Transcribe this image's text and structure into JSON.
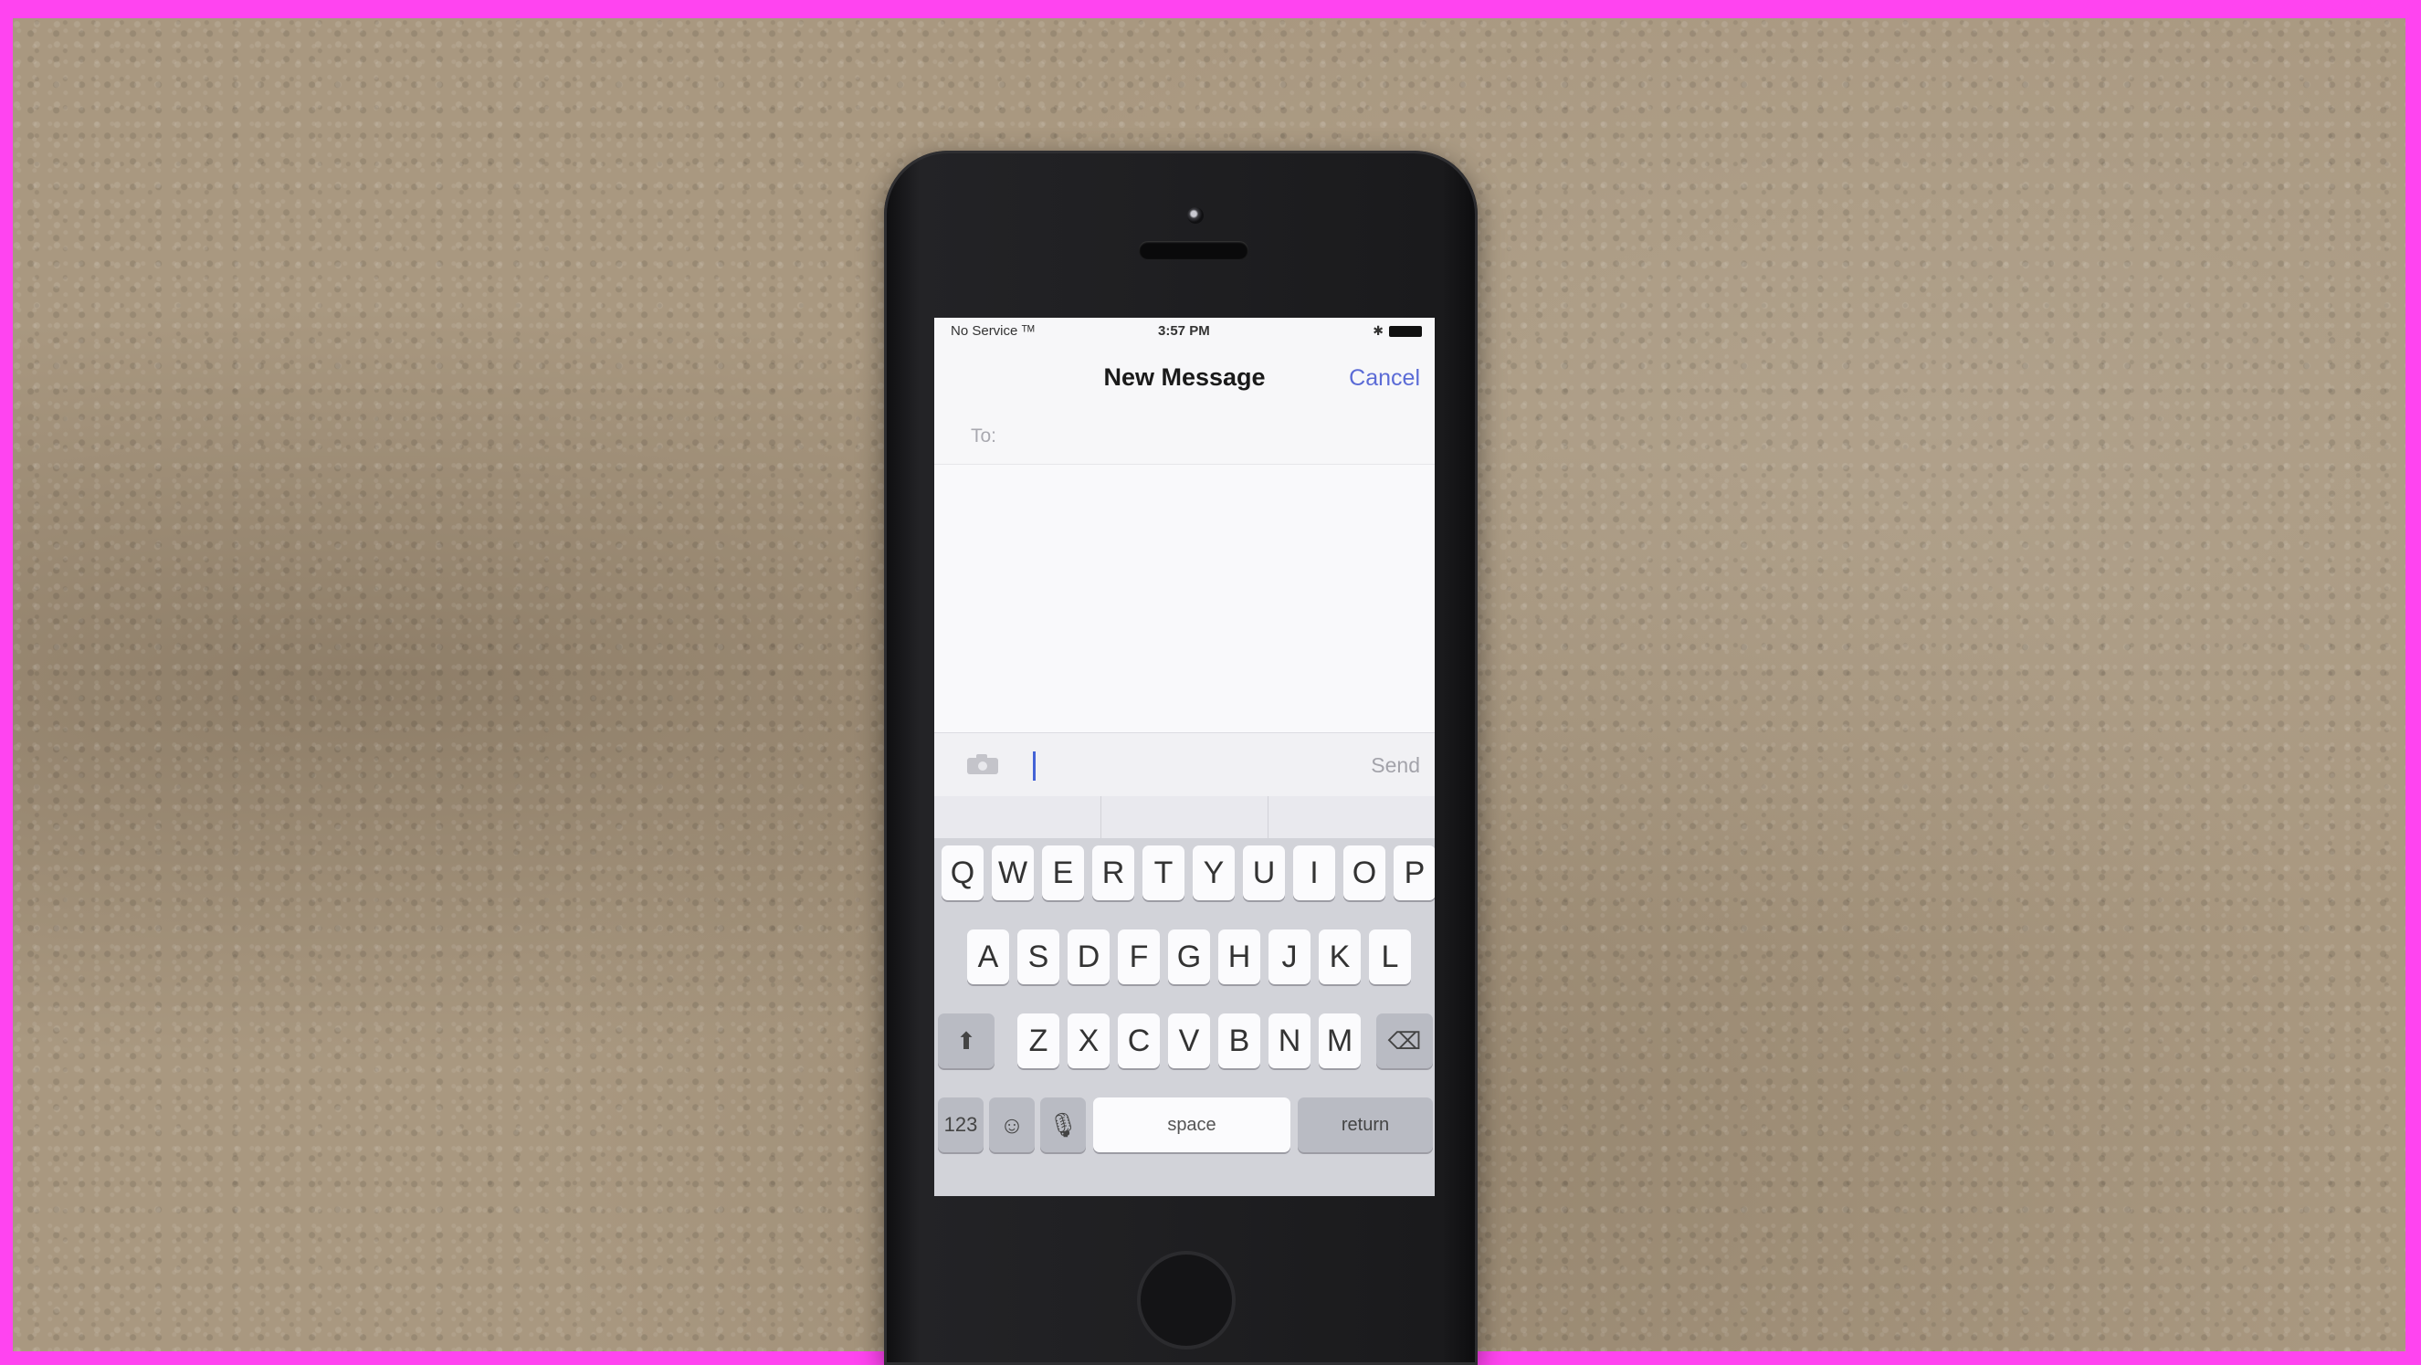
{
  "status_bar": {
    "carrier": "No Service ᵀᴹ",
    "time": "3:57 PM"
  },
  "nav": {
    "title": "New Message",
    "cancel_label": "Cancel"
  },
  "compose": {
    "to_label": "To:",
    "send_label": "Send"
  },
  "keyboard": {
    "row1": [
      "Q",
      "W",
      "E",
      "R",
      "T",
      "Y",
      "U",
      "I",
      "O",
      "P"
    ],
    "row2": [
      "A",
      "S",
      "D",
      "F",
      "G",
      "H",
      "J",
      "K",
      "L"
    ],
    "row3": [
      "Z",
      "X",
      "C",
      "V",
      "B",
      "N",
      "M"
    ],
    "numbers_label": "123",
    "space_label": "space",
    "return_label": "return"
  },
  "colors": {
    "accent": "#5b6bd6",
    "frame": "#ff44f0"
  }
}
